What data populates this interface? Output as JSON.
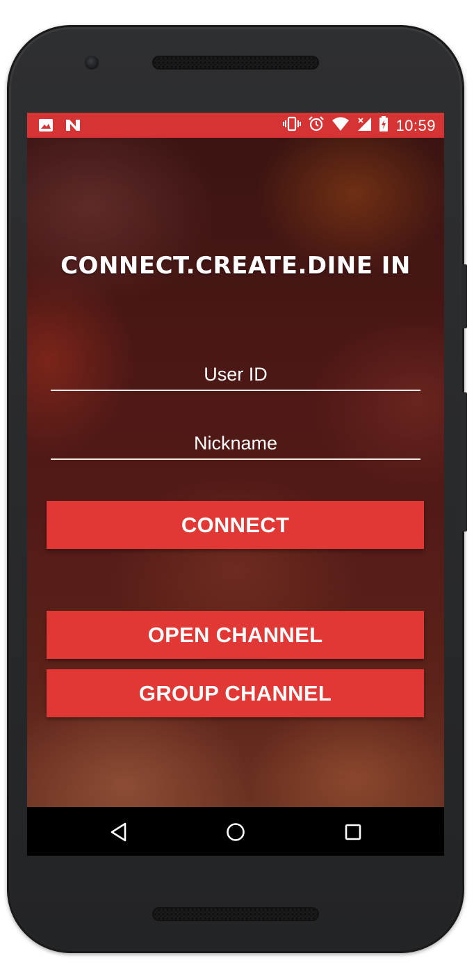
{
  "status_bar": {
    "left_icons": [
      "image-icon",
      "n-notification-icon"
    ],
    "right_icons": [
      "vibrate-icon",
      "alarm-icon",
      "wifi-icon",
      "signal-icon",
      "battery-charging-icon"
    ],
    "time": "10:59",
    "color": "#d63434"
  },
  "main": {
    "title": "CONNECT.CREATE.DINE IN",
    "user_id_field": {
      "placeholder": "User ID",
      "value": ""
    },
    "nickname_field": {
      "placeholder": "Nickname",
      "value": ""
    },
    "connect_button": "CONNECT",
    "open_channel_button": "OPEN CHANNEL",
    "group_channel_button": "GROUP CHANNEL",
    "accent_color": "#e23835"
  },
  "nav_bar": {
    "buttons": [
      "back-icon",
      "home-icon",
      "recents-icon"
    ]
  }
}
